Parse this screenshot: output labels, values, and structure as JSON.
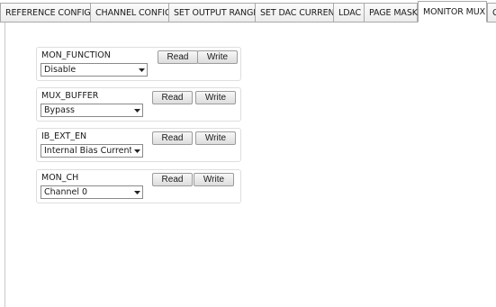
{
  "tabs": [
    {
      "label": "REFERENCE CONFIG",
      "active": false
    },
    {
      "label": "CHANNEL CONFIG",
      "active": false
    },
    {
      "label": "SET OUTPUT RANGE",
      "active": false
    },
    {
      "label": "SET DAC CURRENT",
      "active": false
    },
    {
      "label": "LDAC",
      "active": false
    },
    {
      "label": "PAGE MASK",
      "active": false
    },
    {
      "label": "MONITOR MUX",
      "active": true
    },
    {
      "label": "C",
      "active": false
    }
  ],
  "groups": [
    {
      "label": "MON_FUNCTION",
      "value": "Disable",
      "read_label": "Read",
      "write_label": "Write"
    },
    {
      "label": "MUX_BUFFER",
      "value": "Bypass",
      "read_label": "Read",
      "write_label": "Write"
    },
    {
      "label": "IB_EXT_EN",
      "value": "Internal Bias Current",
      "read_label": "Read",
      "write_label": "Write"
    },
    {
      "label": "MON_CH",
      "value": "Channel 0",
      "read_label": "Read",
      "write_label": "Write"
    }
  ]
}
